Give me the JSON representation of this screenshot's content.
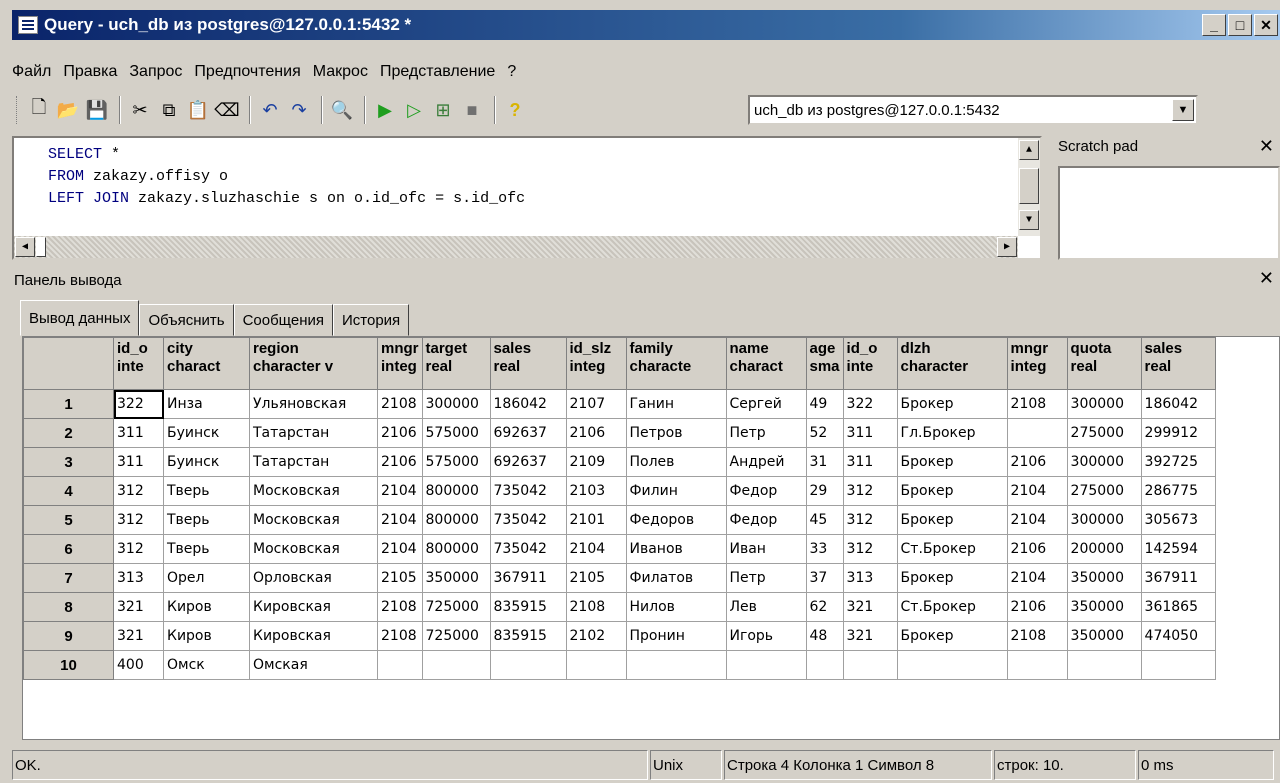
{
  "window": {
    "title": "Query - uch_db из postgres@127.0.0.1:5432 *"
  },
  "menu": [
    "Файл",
    "Правка",
    "Запрос",
    "Предпочтения",
    "Макрос",
    "Представление",
    "?"
  ],
  "connection": "uch_db из postgres@127.0.0.1:5432",
  "editor": {
    "lines": [
      {
        "kw": "SELECT",
        "rest": " *"
      },
      {
        "kw": "FROM",
        "rest": " zakazy.offisy o"
      },
      {
        "kw": "LEFT JOIN",
        "rest": " zakazy.sluzhaschie s on o.id_ofc = s.id_ofc"
      }
    ]
  },
  "scratch": {
    "label": "Scratch pad"
  },
  "output": {
    "label": "Панель вывода",
    "tabs": [
      "Вывод данных",
      "Объяснить",
      "Сообщения",
      "История"
    ]
  },
  "grid": {
    "columns": [
      {
        "name": "id_o",
        "type": "inte"
      },
      {
        "name": "city",
        "type": "charact"
      },
      {
        "name": "region",
        "type": "character v"
      },
      {
        "name": "mngr",
        "type": "integ"
      },
      {
        "name": "target",
        "type": "real"
      },
      {
        "name": "sales",
        "type": "real"
      },
      {
        "name": "id_slz",
        "type": "integ"
      },
      {
        "name": "family",
        "type": "characte"
      },
      {
        "name": "name",
        "type": "charact"
      },
      {
        "name": "age",
        "type": "sma"
      },
      {
        "name": "id_o",
        "type": "inte"
      },
      {
        "name": "dlzh",
        "type": "character"
      },
      {
        "name": "mngr",
        "type": "integ"
      },
      {
        "name": "quota",
        "type": "real"
      },
      {
        "name": "sales",
        "type": "real"
      }
    ],
    "rows": [
      [
        "1",
        "322",
        "Инза",
        "Ульяновская",
        "2108",
        "300000",
        "186042",
        "2107",
        "Ганин",
        "Сергей",
        "49",
        "322",
        "Брокер",
        "2108",
        "300000",
        "186042"
      ],
      [
        "2",
        "311",
        "Буинск",
        "Татарстан",
        "2106",
        "575000",
        "692637",
        "2106",
        "Петров",
        "Петр",
        "52",
        "311",
        "Гл.Брокер",
        "",
        "275000",
        "299912"
      ],
      [
        "3",
        "311",
        "Буинск",
        "Татарстан",
        "2106",
        "575000",
        "692637",
        "2109",
        "Полев",
        "Андрей",
        "31",
        "311",
        "Брокер",
        "2106",
        "300000",
        "392725"
      ],
      [
        "4",
        "312",
        "Тверь",
        "Московская",
        "2104",
        "800000",
        "735042",
        "2103",
        "Филин",
        "Федор",
        "29",
        "312",
        "Брокер",
        "2104",
        "275000",
        "286775"
      ],
      [
        "5",
        "312",
        "Тверь",
        "Московская",
        "2104",
        "800000",
        "735042",
        "2101",
        "Федоров",
        "Федор",
        "45",
        "312",
        "Брокер",
        "2104",
        "300000",
        "305673"
      ],
      [
        "6",
        "312",
        "Тверь",
        "Московская",
        "2104",
        "800000",
        "735042",
        "2104",
        "Иванов",
        "Иван",
        "33",
        "312",
        "Ст.Брокер",
        "2106",
        "200000",
        "142594"
      ],
      [
        "7",
        "313",
        "Орел",
        "Орловская",
        "2105",
        "350000",
        "367911",
        "2105",
        "Филатов",
        "Петр",
        "37",
        "313",
        "Брокер",
        "2104",
        "350000",
        "367911"
      ],
      [
        "8",
        "321",
        "Киров",
        "Кировская",
        "2108",
        "725000",
        "835915",
        "2108",
        "Нилов",
        "Лев",
        "62",
        "321",
        "Ст.Брокер",
        "2106",
        "350000",
        "361865"
      ],
      [
        "9",
        "321",
        "Киров",
        "Кировская",
        "2108",
        "725000",
        "835915",
        "2102",
        "Пронин",
        "Игорь",
        "48",
        "321",
        "Брокер",
        "2108",
        "350000",
        "474050"
      ],
      [
        "10",
        "400",
        "Омск",
        "Омская",
        "",
        "",
        "",
        "",
        "",
        "",
        "",
        "",
        "",
        "",
        "",
        ""
      ]
    ]
  },
  "status": [
    "OK.",
    "Unix",
    "Строка 4 Колонка 1 Символ 8",
    "строк: 10.",
    "0 ms"
  ]
}
